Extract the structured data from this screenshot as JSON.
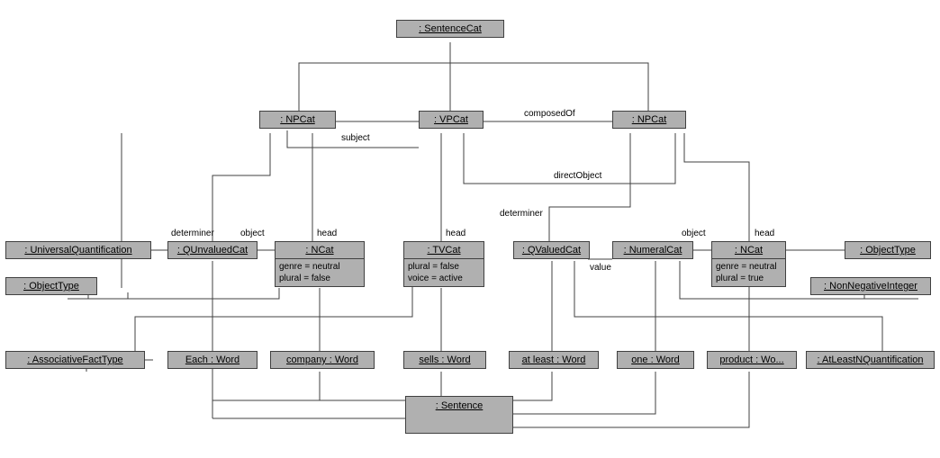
{
  "chart_data": {
    "type": "diagram",
    "diagram_type": "uml-object-diagram",
    "title": "",
    "nodes": [
      {
        "id": "sentencecat",
        "label": ": SentenceCat",
        "attrs": []
      },
      {
        "id": "npcat1",
        "label": ": NPCat",
        "attrs": []
      },
      {
        "id": "vpcat",
        "label": ": VPCat",
        "attrs": []
      },
      {
        "id": "npcat2",
        "label": ": NPCat",
        "attrs": []
      },
      {
        "id": "univquant",
        "label": ": UniversalQuantification",
        "attrs": []
      },
      {
        "id": "qunvaluedcat",
        "label": ": QUnvaluedCat",
        "attrs": []
      },
      {
        "id": "ncat1",
        "label": ": NCat",
        "attrs": [
          "genre = neutral",
          "plural = false"
        ]
      },
      {
        "id": "tvcat",
        "label": ": TVCat",
        "attrs": [
          "plural = false",
          "voice = active"
        ]
      },
      {
        "id": "qvaluedcat",
        "label": ": QValuedCat",
        "attrs": []
      },
      {
        "id": "numeralcat",
        "label": ": NumeralCat",
        "attrs": []
      },
      {
        "id": "ncat2",
        "label": ": NCat",
        "attrs": [
          "genre = neutral",
          "plural = true"
        ]
      },
      {
        "id": "objtype1",
        "label": ": ObjectType",
        "attrs": []
      },
      {
        "id": "objtype2",
        "label": ": ObjectType",
        "attrs": []
      },
      {
        "id": "nonnegint",
        "label": ": NonNegativeInteger",
        "attrs": []
      },
      {
        "id": "assocfacttype",
        "label": ": AssociativeFactType",
        "attrs": []
      },
      {
        "id": "eachword",
        "label": "Each : Word",
        "attrs": []
      },
      {
        "id": "companyword",
        "label": "company : Word",
        "attrs": []
      },
      {
        "id": "sellsword",
        "label": "sells : Word",
        "attrs": []
      },
      {
        "id": "atleastword",
        "label": "at least : Word",
        "attrs": []
      },
      {
        "id": "oneword",
        "label": "one : Word",
        "attrs": []
      },
      {
        "id": "productword",
        "label": "product : Wo...",
        "attrs": []
      },
      {
        "id": "atleastnquant",
        "label": ": AtLeastNQuantification",
        "attrs": []
      },
      {
        "id": "sentence",
        "label": ": Sentence",
        "attrs": []
      }
    ],
    "edges": [
      {
        "from": "sentencecat",
        "to": "npcat1",
        "label": ""
      },
      {
        "from": "sentencecat",
        "to": "vpcat",
        "label": ""
      },
      {
        "from": "sentencecat",
        "to": "npcat2",
        "label": "composedOf"
      },
      {
        "from": "npcat1",
        "to": "vpcat",
        "label": "subject"
      },
      {
        "from": "vpcat",
        "to": "npcat2",
        "label": "directObject"
      },
      {
        "from": "npcat1",
        "to": "qunvaluedcat",
        "label": "determiner"
      },
      {
        "from": "npcat1",
        "to": "ncat1",
        "label": "head"
      },
      {
        "from": "vpcat",
        "to": "tvcat",
        "label": "head"
      },
      {
        "from": "npcat2",
        "to": "qvaluedcat",
        "label": "determiner"
      },
      {
        "from": "npcat2",
        "to": "ncat2",
        "label": "head"
      },
      {
        "from": "qunvaluedcat",
        "to": "univquant",
        "label": ""
      },
      {
        "from": "qunvaluedcat",
        "to": "ncat1",
        "label": "object"
      },
      {
        "from": "ncat1",
        "to": "objtype1",
        "label": ""
      },
      {
        "from": "tvcat",
        "to": "assocfacttype",
        "label": ""
      },
      {
        "from": "qvaluedcat",
        "to": "numeralcat",
        "label": "value"
      },
      {
        "from": "qvaluedcat",
        "to": "atleastnquant",
        "label": ""
      },
      {
        "from": "numeralcat",
        "to": "ncat2",
        "label": "object"
      },
      {
        "from": "numeralcat",
        "to": "nonnegint",
        "label": ""
      },
      {
        "from": "ncat2",
        "to": "objtype2",
        "label": ""
      },
      {
        "from": "qunvaluedcat",
        "to": "eachword",
        "label": ""
      },
      {
        "from": "ncat1",
        "to": "companyword",
        "label": ""
      },
      {
        "from": "tvcat",
        "to": "sellsword",
        "label": ""
      },
      {
        "from": "qvaluedcat",
        "to": "atleastword",
        "label": ""
      },
      {
        "from": "numeralcat",
        "to": "oneword",
        "label": ""
      },
      {
        "from": "ncat2",
        "to": "productword",
        "label": ""
      },
      {
        "from": "eachword",
        "to": "sentence",
        "label": ""
      },
      {
        "from": "companyword",
        "to": "sentence",
        "label": ""
      },
      {
        "from": "sellsword",
        "to": "sentence",
        "label": ""
      },
      {
        "from": "atleastword",
        "to": "sentence",
        "label": ""
      },
      {
        "from": "oneword",
        "to": "sentence",
        "label": ""
      },
      {
        "from": "productword",
        "to": "sentence",
        "label": ""
      }
    ]
  },
  "labels": {
    "composedOf": "composedOf",
    "subject": "subject",
    "directObject": "directObject",
    "determiner1": "determiner",
    "determiner2": "determiner",
    "object1": "object",
    "object2": "object",
    "head1": "head",
    "head2": "head",
    "head3": "head",
    "value": "value"
  }
}
